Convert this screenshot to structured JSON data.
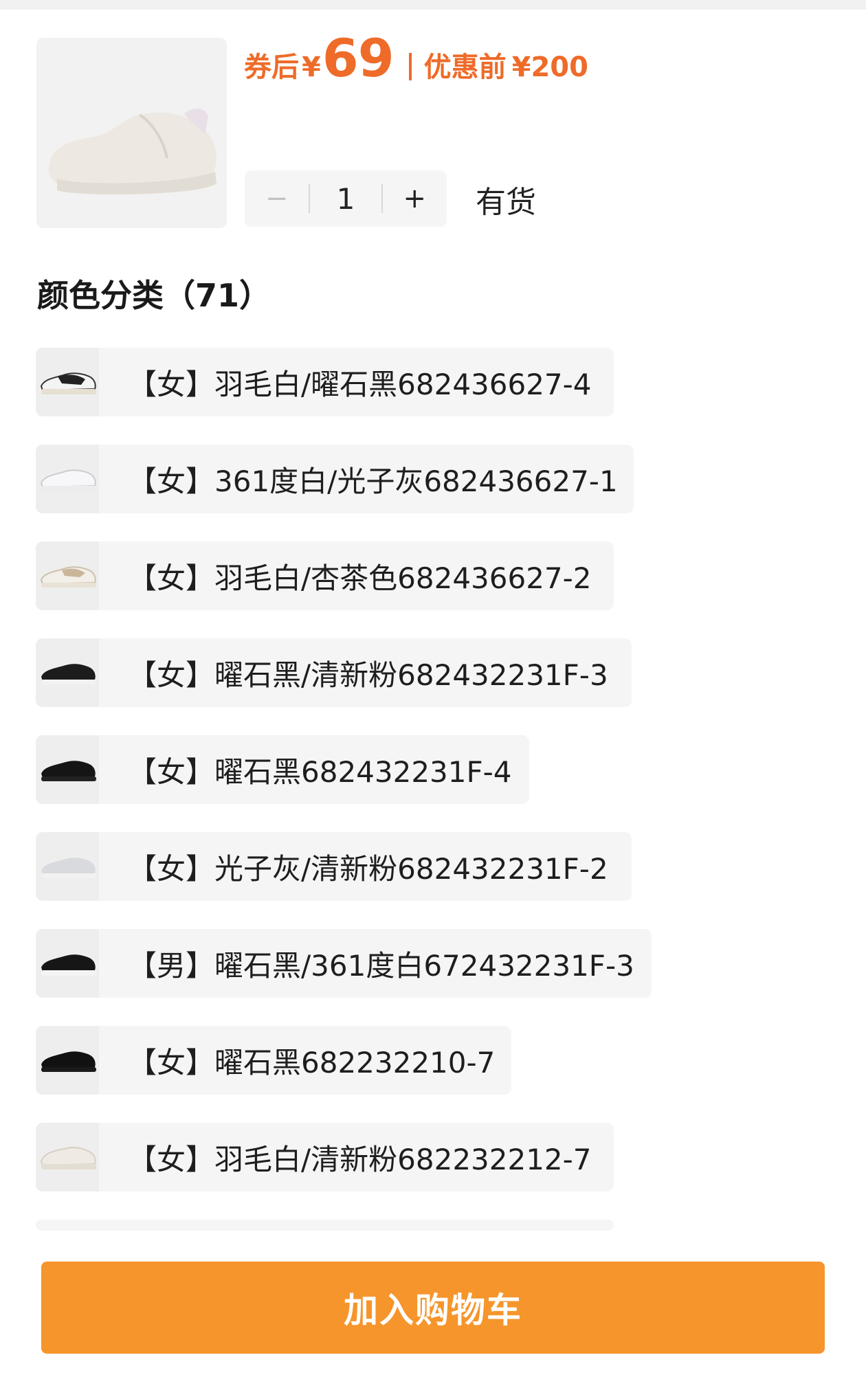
{
  "product": {
    "price_label": "券后",
    "currency": "¥",
    "price": "69",
    "original_label": "优惠前",
    "original_price": "¥200",
    "quantity": "1",
    "minus_symbol": "−",
    "plus_symbol": "+",
    "stock_status": "有货",
    "accent_color": "#ee6b29"
  },
  "section": {
    "title": "颜色分类（71）"
  },
  "variants": [
    {
      "label": "【女】羽毛白/曜石黑682436627-4",
      "icon": "sneaker-white-black-thumb"
    },
    {
      "label": "【女】361度白/光子灰682436627-1",
      "icon": "sneaker-white-thumb"
    },
    {
      "label": "【女】羽毛白/杏茶色682436627-2",
      "icon": "sneaker-beige-thumb"
    },
    {
      "label": "【女】曜石黑/清新粉682432231F-3",
      "icon": "sneaker-black-pink-thumb"
    },
    {
      "label": "【女】曜石黑682432231F-4",
      "icon": "sneaker-black-thumb"
    },
    {
      "label": "【女】光子灰/清新粉682432231F-2",
      "icon": "sneaker-grey-thumb"
    },
    {
      "label": "【男】曜石黑/361度白672432231F-3",
      "icon": "sneaker-black-white-thumb"
    },
    {
      "label": "【女】曜石黑682232210-7",
      "icon": "sneaker-black-thumb"
    },
    {
      "label": "【女】羽毛白/清新粉682232212-7",
      "icon": "sneaker-white-pink-thumb"
    }
  ],
  "cta": {
    "label": "加入购物车",
    "color": "#f6952b"
  }
}
